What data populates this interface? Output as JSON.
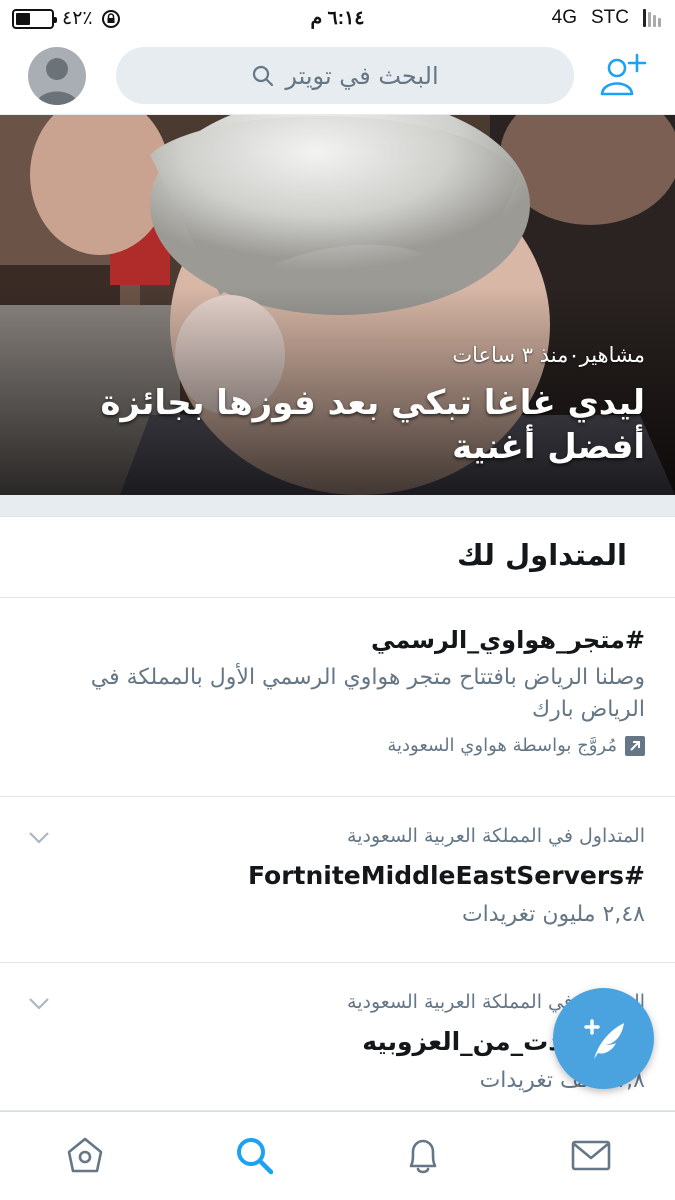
{
  "status_bar": {
    "battery": "٤٢٪",
    "battery_level": 0.42,
    "time": "٦:١٤ م",
    "network": "4G",
    "carrier": "STC"
  },
  "nav": {
    "search_placeholder": "البحث في تويتر",
    "icons": [
      "avatar",
      "search-icon",
      "add-user-icon"
    ]
  },
  "hero": {
    "meta": "مشاهير٠منذ ٣ ساعات",
    "title": "ليدي غاغا تبكي بعد فوزها بجائزة أفضل أغنية"
  },
  "trends": {
    "header": "المتداول لك",
    "promoted": {
      "tag": "#متجر_هواوي_الرسمي",
      "description": "وصلنا الرياض بافتتاح متجر هواوي الرسمي الأول بالمملكة في الرياض بارك",
      "promoted_by": "مُروَّج بواسطة هواوي السعودية"
    },
    "items": [
      {
        "context": "المتداول في المملكة العربية السعودية",
        "name": "#FortniteMiddleEastServers",
        "count": "٢,٤٨ مليون تغريدات"
      },
      {
        "context": "المتداول في المملكة العربية السعودية",
        "name": "#استفدت_من_العزوبيه",
        "count": "١١,٨ ألف تغريدات"
      }
    ]
  },
  "colors": {
    "accent": "#4aa3df",
    "muted": "#657786",
    "separator": "#e6ecf0"
  }
}
